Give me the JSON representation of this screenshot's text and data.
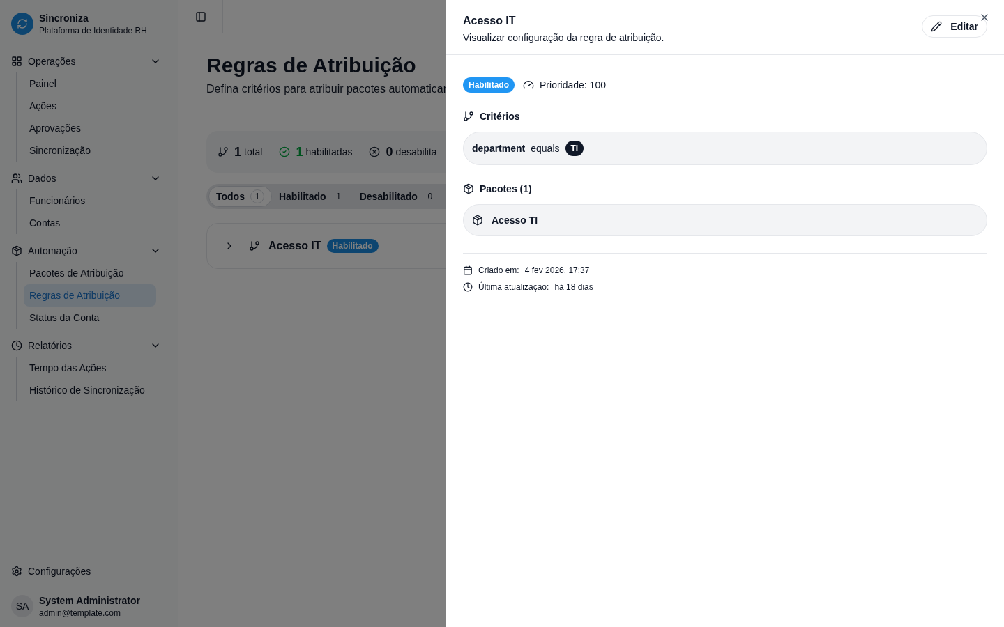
{
  "app": {
    "name": "Sincroniza",
    "subtitle": "Plataforma de Identidade RH"
  },
  "sidebar": {
    "groups": [
      {
        "label": "Operações",
        "expanded": true,
        "items": [
          {
            "label": "Painel",
            "selected": false
          },
          {
            "label": "Ações",
            "selected": false
          },
          {
            "label": "Aprovações",
            "selected": false
          },
          {
            "label": "Sincronização",
            "selected": false
          }
        ]
      },
      {
        "label": "Dados",
        "expanded": true,
        "items": [
          {
            "label": "Funcionários",
            "selected": false
          },
          {
            "label": "Contas",
            "selected": false
          }
        ]
      },
      {
        "label": "Automação",
        "expanded": true,
        "items": [
          {
            "label": "Pacotes de Atribuição",
            "selected": false
          },
          {
            "label": "Regras de Atribuição",
            "selected": true
          },
          {
            "label": "Status da Conta",
            "selected": false
          }
        ]
      },
      {
        "label": "Relatórios",
        "expanded": true,
        "items": [
          {
            "label": "Tempo das Ações",
            "selected": false
          },
          {
            "label": "Histórico de Sincronização",
            "selected": false
          }
        ]
      }
    ],
    "settings": "Configurações",
    "user": {
      "initials": "SA",
      "name": "System Administrator",
      "email": "admin@template.com"
    }
  },
  "page": {
    "title": "Regras de Atribuição",
    "subtitle": "Defina critérios para atribuir pacotes automaticar",
    "stats": [
      {
        "kind": "total",
        "value": "1",
        "label": "total"
      },
      {
        "kind": "enabled",
        "value": "1",
        "label": "habilitadas"
      },
      {
        "kind": "disabled",
        "value": "0",
        "label": "desabilita"
      }
    ],
    "tabs": [
      {
        "label": "Todos",
        "count": "1",
        "selected": true
      },
      {
        "label": "Habilitado",
        "count": "1",
        "selected": false
      },
      {
        "label": "Desabilitado",
        "count": "0",
        "selected": false
      }
    ],
    "rules": [
      {
        "name": "Acesso IT",
        "status": "Habilitado",
        "expanded": false
      }
    ]
  },
  "sheet": {
    "title": "Acesso IT",
    "description": "Visualizar configuração da regra de atribuição.",
    "edit": "Editar",
    "status": "Habilitado",
    "priority": "Prioridade: 100",
    "criteria_heading": "Critérios",
    "criteria": [
      {
        "field": "department",
        "operator": "equals",
        "value": "TI"
      }
    ],
    "packages_heading": "Pacotes (1)",
    "packages": [
      "Acesso TI"
    ],
    "meta": [
      {
        "kind": "created",
        "label": "Criado em:",
        "value": "4 fev 2026, 17:37"
      },
      {
        "kind": "updated",
        "label": "Última atualização:",
        "value": "há 18 dias"
      }
    ]
  }
}
